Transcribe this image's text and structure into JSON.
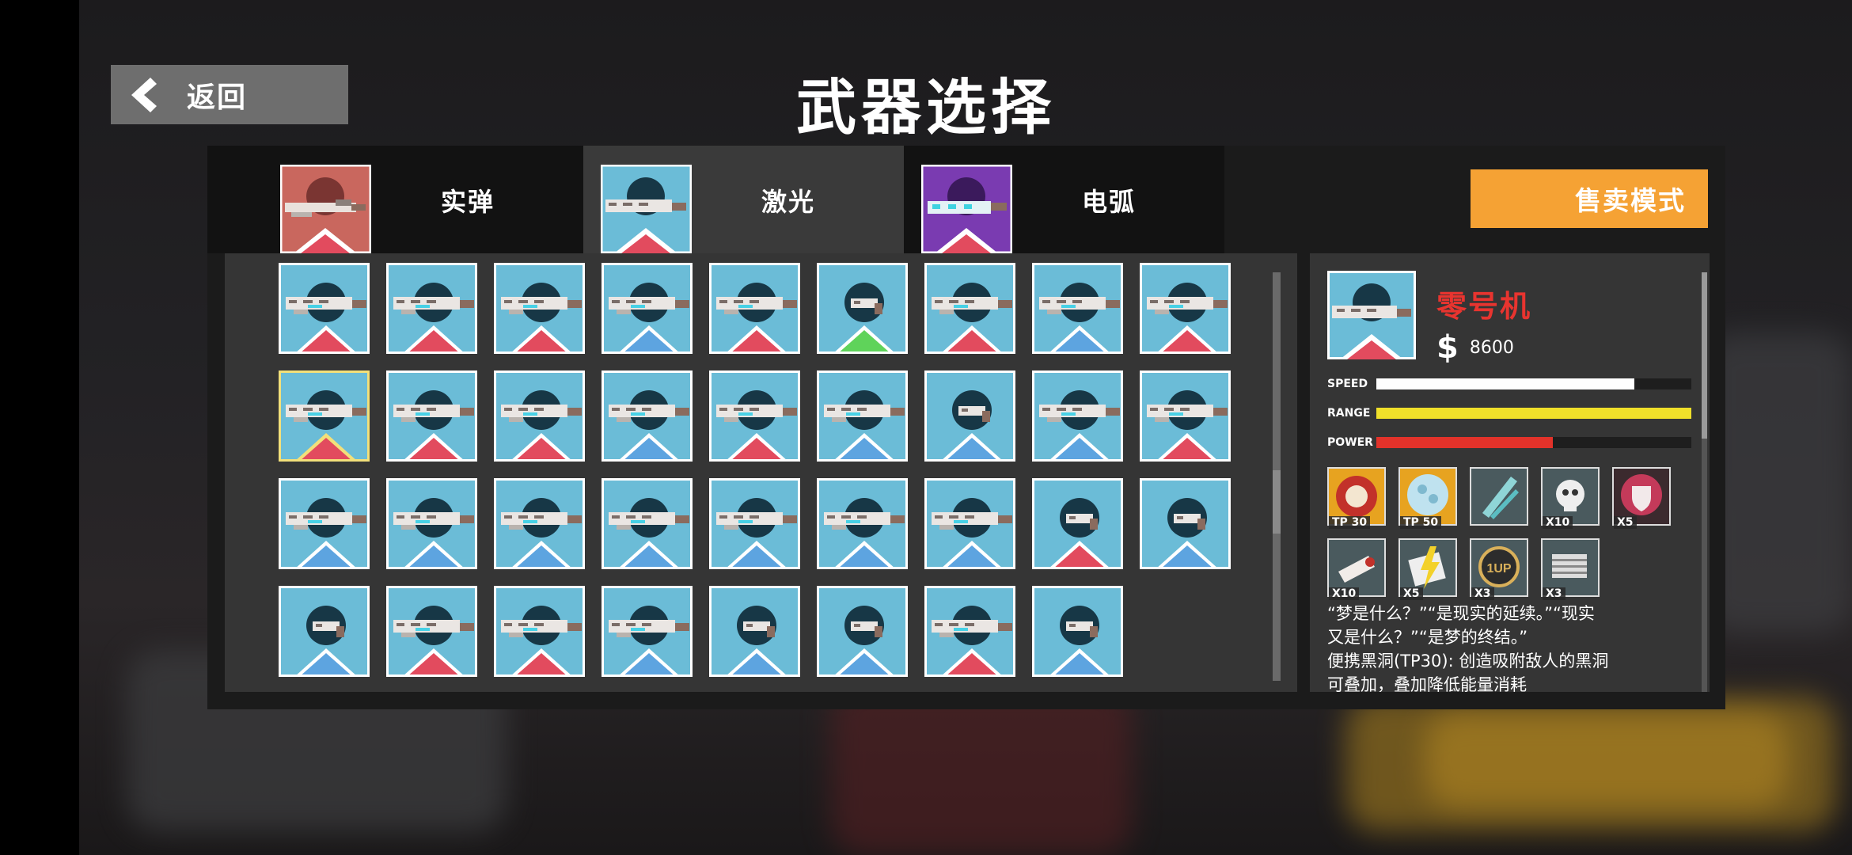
{
  "header": {
    "back_label": "返回",
    "title": "武器选择"
  },
  "tabs": [
    {
      "label": "实弹",
      "icon": "kinetic-gun-icon",
      "active": false
    },
    {
      "label": "激光",
      "icon": "laser-gun-icon",
      "active": true
    },
    {
      "label": "电弧",
      "icon": "arc-gun-icon",
      "active": false
    }
  ],
  "sell_mode_label": "售卖模式",
  "grid": {
    "rows": [
      [
        "rifle-red",
        "rifle-red",
        "rifle-red",
        "rifle-blue",
        "rifle-red",
        "pistol-green",
        "rifle-red",
        "rifle-blue",
        "rifle-red"
      ],
      [
        "rifle-selected",
        "rifle-red",
        "rifle-red",
        "rifle-blue",
        "rifle-red",
        "rifle-blue",
        "pistol-blue",
        "rifle-blue",
        "rifle-red"
      ],
      [
        "rifle-blue",
        "rifle-blue",
        "rifle-blue",
        "rifle-blue",
        "rifle-blue",
        "rifle-blue",
        "rifle-blue",
        "pistol-red",
        "pistol-blue"
      ],
      [
        "pistol-blue",
        "rifle-red",
        "rifle-red",
        "rifle-blue",
        "pistol-blue",
        "pistol-blue",
        "rifle-red",
        "pistol-blue"
      ]
    ]
  },
  "detail": {
    "name": "零号机",
    "price": "8600",
    "stats": [
      {
        "label": "SPEED",
        "value": 0.82,
        "color": "#ffffff"
      },
      {
        "label": "RANGE",
        "value": 1.0,
        "color": "#f0e02a"
      },
      {
        "label": "POWER",
        "value": 0.56,
        "color": "#e2322a"
      }
    ],
    "perks_row1": [
      {
        "icon": "saw-blade-icon",
        "label": "TP 30"
      },
      {
        "icon": "energy-ball-icon",
        "label": "TP 50"
      },
      {
        "icon": "blade-icon",
        "label": ""
      },
      {
        "icon": "skull-icon",
        "label": "X10"
      },
      {
        "icon": "shield-icon",
        "label": "X5"
      }
    ],
    "perks_row2": [
      {
        "icon": "ammo-icon",
        "label": "X10"
      },
      {
        "icon": "lightning-icon",
        "label": "X5"
      },
      {
        "icon": "1up-coin-icon",
        "label": "X3"
      },
      {
        "icon": "armor-plate-icon",
        "label": "X3"
      }
    ],
    "description_line1": "“梦是什么？”“是现实的延续。”“现实",
    "description_line2": "又是什么？”“是梦的终结。”",
    "description_line3": "便携黑洞(TP30): 创造吸附敌人的黑洞",
    "description_line4": "可叠加，叠加降低能量消耗"
  },
  "colors": {
    "accent_orange": "#f5a234",
    "tile_blue": "#6bbcd7",
    "tri_red": "#e24b5e",
    "tri_blue": "#5da4e0",
    "tri_green": "#5fd35a",
    "name_red": "#e8342f"
  }
}
